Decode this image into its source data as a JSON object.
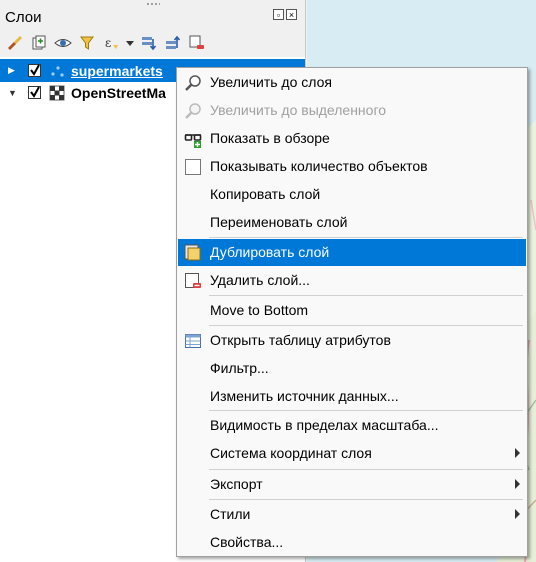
{
  "panel": {
    "title": "Слои",
    "toolbar_icons": [
      "style-brush-icon",
      "add-group-icon",
      "visibility-eye-icon",
      "filter-funnel-icon",
      "expression-filter-icon",
      "expand-all-icon",
      "collapse-all-icon",
      "remove-layer-icon"
    ]
  },
  "layers": [
    {
      "name": "supermarkets",
      "checked": true,
      "selected": true,
      "expanded": false
    },
    {
      "name": "OpenStreetMa",
      "checked": true,
      "selected": false,
      "expanded": true
    }
  ],
  "menu": {
    "items": [
      {
        "label": "Увеличить до слоя",
        "icon": "zoom-to-layer-icon"
      },
      {
        "label": "Увеличить до выделенного",
        "icon": "zoom-to-selection-icon",
        "disabled": true
      },
      {
        "label": "Показать в обзоре",
        "icon": "overview-glasses-icon"
      },
      {
        "label": "Показывать количество объектов",
        "icon": "checkbox-icon"
      },
      {
        "label": "Копировать слой"
      },
      {
        "label": "Переименовать слой"
      },
      {
        "label": "Дублировать слой",
        "icon": "duplicate-layer-icon",
        "highlighted": true
      },
      {
        "label": "Удалить слой...",
        "icon": "remove-layer-icon"
      },
      {
        "label": "Move to Bottom"
      },
      {
        "label": "Открыть таблицу атрибутов",
        "icon": "attribute-table-icon"
      },
      {
        "label": "Фильтр..."
      },
      {
        "label": "Изменить источник данных..."
      },
      {
        "label": "Видимость в пределах масштаба..."
      },
      {
        "label": "Система координат слоя",
        "submenu": true
      },
      {
        "label": "Экспорт",
        "submenu": true
      },
      {
        "label": "Стили",
        "submenu": true
      },
      {
        "label": "Свойства..."
      }
    ]
  },
  "colors": {
    "selection": "#0078d7",
    "menu_bg": "#f9f9f9",
    "map_water": "#d6ecf2"
  }
}
